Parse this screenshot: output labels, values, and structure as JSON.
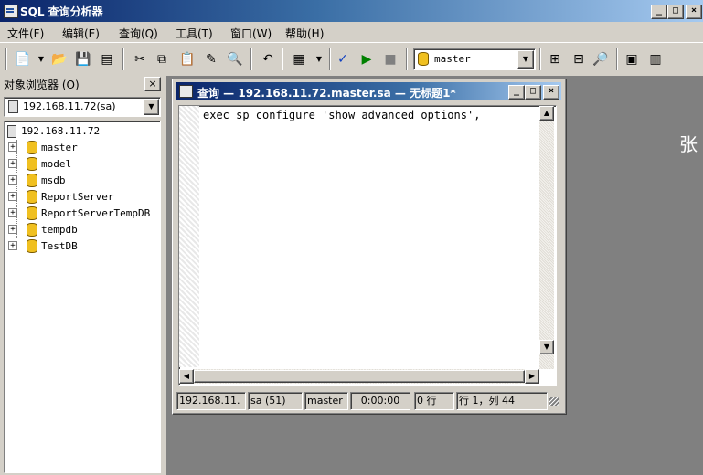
{
  "window": {
    "title": "SQL 查询分析器",
    "caption_buttons": [
      "_",
      "□",
      "×"
    ]
  },
  "menu": [
    "文件(F)",
    "编辑(E)",
    "查询(Q)",
    "工具(T)",
    "窗口(W)",
    "帮助(H)"
  ],
  "toolbar": {
    "database_selected": "master"
  },
  "object_browser": {
    "title": "对象浏览器 (O)",
    "close": "×",
    "server_combo": "192.168.11.72(sa)",
    "server_node": "192.168.11.72",
    "databases": [
      "master",
      "model",
      "msdb",
      "ReportServer",
      "ReportServerTempDB",
      "tempdb",
      "TestDB"
    ]
  },
  "query_window": {
    "title": "查询 — 192.168.11.72.master.sa — 无标题1*",
    "code": "exec sp_configure 'show advanced options',",
    "status": {
      "server": "192.168.11.",
      "user": "sa (51)",
      "database": "master",
      "time": "0:00:00",
      "rows": "0 行",
      "position": "行 1，列 44"
    }
  },
  "side_text": "张"
}
